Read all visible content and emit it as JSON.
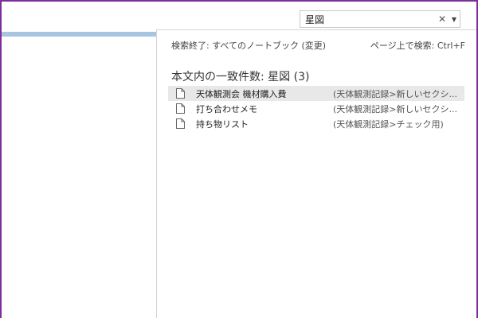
{
  "search": {
    "value": "星図",
    "clear_icon": "close-icon",
    "dropdown_icon": "chevron-down-icon"
  },
  "panel": {
    "scope_label": "検索終了: すべてのノートブック (変更)",
    "page_search_hint": "ページ上で検索: Ctrl+F",
    "results_heading": "本文内の一致件数: 星図 (3)",
    "results": [
      {
        "title": "天体観測会 機材購入費",
        "path": "(天体観測記録>新しいセクシ...",
        "icon": "page-icon",
        "selected": true
      },
      {
        "title": "打ち合わせメモ",
        "path": "(天体観測記録>新しいセクシ...",
        "icon": "page-icon",
        "selected": false
      },
      {
        "title": "持ち物リスト",
        "path": "(天体観測記録>チェック用)",
        "icon": "page-icon",
        "selected": false
      }
    ]
  },
  "colors": {
    "window_border": "#7d2e9a",
    "page_bar": "#a7c4e0",
    "selected_row": "#e8e8e8"
  }
}
